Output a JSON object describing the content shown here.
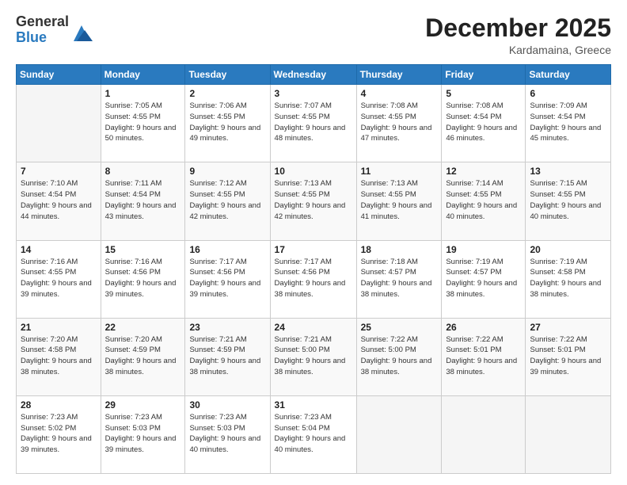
{
  "logo": {
    "general": "General",
    "blue": "Blue"
  },
  "header": {
    "month": "December 2025",
    "location": "Kardamaina, Greece"
  },
  "weekdays": [
    "Sunday",
    "Monday",
    "Tuesday",
    "Wednesday",
    "Thursday",
    "Friday",
    "Saturday"
  ],
  "weeks": [
    [
      {
        "day": "",
        "sunrise": "",
        "sunset": "",
        "daylight": ""
      },
      {
        "day": "1",
        "sunrise": "Sunrise: 7:05 AM",
        "sunset": "Sunset: 4:55 PM",
        "daylight": "Daylight: 9 hours and 50 minutes."
      },
      {
        "day": "2",
        "sunrise": "Sunrise: 7:06 AM",
        "sunset": "Sunset: 4:55 PM",
        "daylight": "Daylight: 9 hours and 49 minutes."
      },
      {
        "day": "3",
        "sunrise": "Sunrise: 7:07 AM",
        "sunset": "Sunset: 4:55 PM",
        "daylight": "Daylight: 9 hours and 48 minutes."
      },
      {
        "day": "4",
        "sunrise": "Sunrise: 7:08 AM",
        "sunset": "Sunset: 4:55 PM",
        "daylight": "Daylight: 9 hours and 47 minutes."
      },
      {
        "day": "5",
        "sunrise": "Sunrise: 7:08 AM",
        "sunset": "Sunset: 4:54 PM",
        "daylight": "Daylight: 9 hours and 46 minutes."
      },
      {
        "day": "6",
        "sunrise": "Sunrise: 7:09 AM",
        "sunset": "Sunset: 4:54 PM",
        "daylight": "Daylight: 9 hours and 45 minutes."
      }
    ],
    [
      {
        "day": "7",
        "sunrise": "Sunrise: 7:10 AM",
        "sunset": "Sunset: 4:54 PM",
        "daylight": "Daylight: 9 hours and 44 minutes."
      },
      {
        "day": "8",
        "sunrise": "Sunrise: 7:11 AM",
        "sunset": "Sunset: 4:54 PM",
        "daylight": "Daylight: 9 hours and 43 minutes."
      },
      {
        "day": "9",
        "sunrise": "Sunrise: 7:12 AM",
        "sunset": "Sunset: 4:55 PM",
        "daylight": "Daylight: 9 hours and 42 minutes."
      },
      {
        "day": "10",
        "sunrise": "Sunrise: 7:13 AM",
        "sunset": "Sunset: 4:55 PM",
        "daylight": "Daylight: 9 hours and 42 minutes."
      },
      {
        "day": "11",
        "sunrise": "Sunrise: 7:13 AM",
        "sunset": "Sunset: 4:55 PM",
        "daylight": "Daylight: 9 hours and 41 minutes."
      },
      {
        "day": "12",
        "sunrise": "Sunrise: 7:14 AM",
        "sunset": "Sunset: 4:55 PM",
        "daylight": "Daylight: 9 hours and 40 minutes."
      },
      {
        "day": "13",
        "sunrise": "Sunrise: 7:15 AM",
        "sunset": "Sunset: 4:55 PM",
        "daylight": "Daylight: 9 hours and 40 minutes."
      }
    ],
    [
      {
        "day": "14",
        "sunrise": "Sunrise: 7:16 AM",
        "sunset": "Sunset: 4:55 PM",
        "daylight": "Daylight: 9 hours and 39 minutes."
      },
      {
        "day": "15",
        "sunrise": "Sunrise: 7:16 AM",
        "sunset": "Sunset: 4:56 PM",
        "daylight": "Daylight: 9 hours and 39 minutes."
      },
      {
        "day": "16",
        "sunrise": "Sunrise: 7:17 AM",
        "sunset": "Sunset: 4:56 PM",
        "daylight": "Daylight: 9 hours and 39 minutes."
      },
      {
        "day": "17",
        "sunrise": "Sunrise: 7:17 AM",
        "sunset": "Sunset: 4:56 PM",
        "daylight": "Daylight: 9 hours and 38 minutes."
      },
      {
        "day": "18",
        "sunrise": "Sunrise: 7:18 AM",
        "sunset": "Sunset: 4:57 PM",
        "daylight": "Daylight: 9 hours and 38 minutes."
      },
      {
        "day": "19",
        "sunrise": "Sunrise: 7:19 AM",
        "sunset": "Sunset: 4:57 PM",
        "daylight": "Daylight: 9 hours and 38 minutes."
      },
      {
        "day": "20",
        "sunrise": "Sunrise: 7:19 AM",
        "sunset": "Sunset: 4:58 PM",
        "daylight": "Daylight: 9 hours and 38 minutes."
      }
    ],
    [
      {
        "day": "21",
        "sunrise": "Sunrise: 7:20 AM",
        "sunset": "Sunset: 4:58 PM",
        "daylight": "Daylight: 9 hours and 38 minutes."
      },
      {
        "day": "22",
        "sunrise": "Sunrise: 7:20 AM",
        "sunset": "Sunset: 4:59 PM",
        "daylight": "Daylight: 9 hours and 38 minutes."
      },
      {
        "day": "23",
        "sunrise": "Sunrise: 7:21 AM",
        "sunset": "Sunset: 4:59 PM",
        "daylight": "Daylight: 9 hours and 38 minutes."
      },
      {
        "day": "24",
        "sunrise": "Sunrise: 7:21 AM",
        "sunset": "Sunset: 5:00 PM",
        "daylight": "Daylight: 9 hours and 38 minutes."
      },
      {
        "day": "25",
        "sunrise": "Sunrise: 7:22 AM",
        "sunset": "Sunset: 5:00 PM",
        "daylight": "Daylight: 9 hours and 38 minutes."
      },
      {
        "day": "26",
        "sunrise": "Sunrise: 7:22 AM",
        "sunset": "Sunset: 5:01 PM",
        "daylight": "Daylight: 9 hours and 38 minutes."
      },
      {
        "day": "27",
        "sunrise": "Sunrise: 7:22 AM",
        "sunset": "Sunset: 5:01 PM",
        "daylight": "Daylight: 9 hours and 39 minutes."
      }
    ],
    [
      {
        "day": "28",
        "sunrise": "Sunrise: 7:23 AM",
        "sunset": "Sunset: 5:02 PM",
        "daylight": "Daylight: 9 hours and 39 minutes."
      },
      {
        "day": "29",
        "sunrise": "Sunrise: 7:23 AM",
        "sunset": "Sunset: 5:03 PM",
        "daylight": "Daylight: 9 hours and 39 minutes."
      },
      {
        "day": "30",
        "sunrise": "Sunrise: 7:23 AM",
        "sunset": "Sunset: 5:03 PM",
        "daylight": "Daylight: 9 hours and 40 minutes."
      },
      {
        "day": "31",
        "sunrise": "Sunrise: 7:23 AM",
        "sunset": "Sunset: 5:04 PM",
        "daylight": "Daylight: 9 hours and 40 minutes."
      },
      {
        "day": "",
        "sunrise": "",
        "sunset": "",
        "daylight": ""
      },
      {
        "day": "",
        "sunrise": "",
        "sunset": "",
        "daylight": ""
      },
      {
        "day": "",
        "sunrise": "",
        "sunset": "",
        "daylight": ""
      }
    ]
  ]
}
